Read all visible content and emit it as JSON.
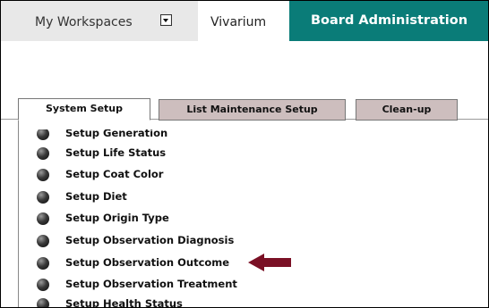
{
  "header": {
    "workspace_label": "My Workspaces",
    "vivarium_label": "Vivarium",
    "board_label": "Board Administration"
  },
  "icons": {
    "workspace_dropdown": "dropdown-arrow-icon",
    "bullet": "bullet-icon",
    "annotation_arrow": "left-arrow-icon"
  },
  "colors": {
    "board_tab_bg": "#0a7c78",
    "inactive_subtab_bg": "#cdbebe",
    "arrow": "#7a1025"
  },
  "subtabs": [
    {
      "label": "System Setup",
      "active": true
    },
    {
      "label": "List Maintenance Setup",
      "active": false
    },
    {
      "label": "Clean-up",
      "active": false
    }
  ],
  "setup_items": [
    "Setup Generation",
    "Setup Life Status",
    "Setup Coat Color",
    "Setup Diet",
    "Setup Origin Type",
    "Setup Observation Diagnosis",
    "Setup Observation Outcome",
    "Setup Observation Treatment",
    "Setup Health Status"
  ]
}
